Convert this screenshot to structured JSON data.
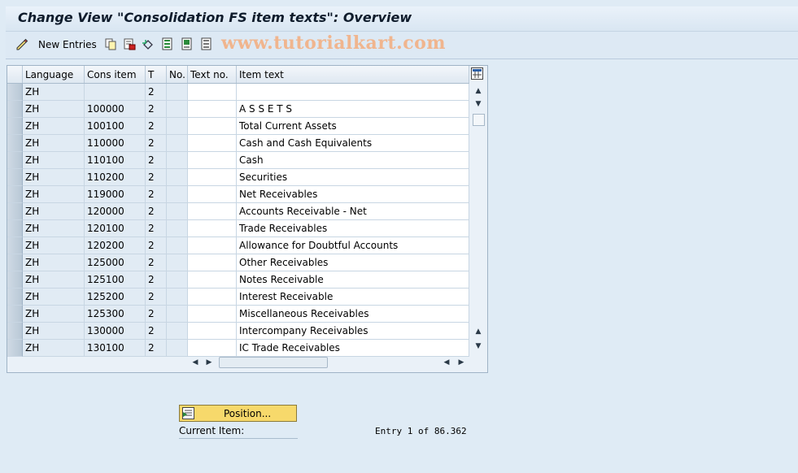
{
  "title": "Change View \"Consolidation FS item texts\": Overview",
  "toolbar": {
    "new_entries_label": "New Entries",
    "watermark": "www.tutorialkart.com",
    "icons": [
      "edit-pencil-icon",
      "copy-icon",
      "delete-icon",
      "undo-icon",
      "select-all-icon",
      "select-block-icon",
      "deselect-all-icon"
    ]
  },
  "table": {
    "columns": [
      "Language",
      "Cons item",
      "T",
      "No.",
      "Text no.",
      "Item text"
    ],
    "rows": [
      {
        "language": "ZH",
        "cons_item": "",
        "t": "2",
        "no": "",
        "text_no": "",
        "item_text": ""
      },
      {
        "language": "ZH",
        "cons_item": "100000",
        "t": "2",
        "no": "",
        "text_no": "",
        "item_text": "A S S E T S"
      },
      {
        "language": "ZH",
        "cons_item": "100100",
        "t": "2",
        "no": "",
        "text_no": "",
        "item_text": "Total Current Assets"
      },
      {
        "language": "ZH",
        "cons_item": "110000",
        "t": "2",
        "no": "",
        "text_no": "",
        "item_text": "Cash and Cash Equivalents"
      },
      {
        "language": "ZH",
        "cons_item": "110100",
        "t": "2",
        "no": "",
        "text_no": "",
        "item_text": "Cash"
      },
      {
        "language": "ZH",
        "cons_item": "110200",
        "t": "2",
        "no": "",
        "text_no": "",
        "item_text": "Securities"
      },
      {
        "language": "ZH",
        "cons_item": "119000",
        "t": "2",
        "no": "",
        "text_no": "",
        "item_text": "Net Receivables"
      },
      {
        "language": "ZH",
        "cons_item": "120000",
        "t": "2",
        "no": "",
        "text_no": "",
        "item_text": "Accounts Receivable - Net"
      },
      {
        "language": "ZH",
        "cons_item": "120100",
        "t": "2",
        "no": "",
        "text_no": "",
        "item_text": "Trade Receivables"
      },
      {
        "language": "ZH",
        "cons_item": "120200",
        "t": "2",
        "no": "",
        "text_no": "",
        "item_text": "Allowance for Doubtful Accounts"
      },
      {
        "language": "ZH",
        "cons_item": "125000",
        "t": "2",
        "no": "",
        "text_no": "",
        "item_text": "Other Receivables"
      },
      {
        "language": "ZH",
        "cons_item": "125100",
        "t": "2",
        "no": "",
        "text_no": "",
        "item_text": "Notes Receivable"
      },
      {
        "language": "ZH",
        "cons_item": "125200",
        "t": "2",
        "no": "",
        "text_no": "",
        "item_text": "Interest Receivable"
      },
      {
        "language": "ZH",
        "cons_item": "125300",
        "t": "2",
        "no": "",
        "text_no": "",
        "item_text": "Miscellaneous Receivables"
      },
      {
        "language": "ZH",
        "cons_item": "130000",
        "t": "2",
        "no": "",
        "text_no": "",
        "item_text": "Intercompany Receivables"
      },
      {
        "language": "ZH",
        "cons_item": "130100",
        "t": "2",
        "no": "",
        "text_no": "",
        "item_text": "IC Trade Receivables"
      }
    ]
  },
  "position_button_label": "Position...",
  "current_item_label": "Current Item:",
  "entry_info": "Entry 1 of 86.362",
  "colors": {
    "background": "#dfebf5",
    "position_button": "#f7d96b",
    "read_only_cell": "#e1ebf4"
  }
}
